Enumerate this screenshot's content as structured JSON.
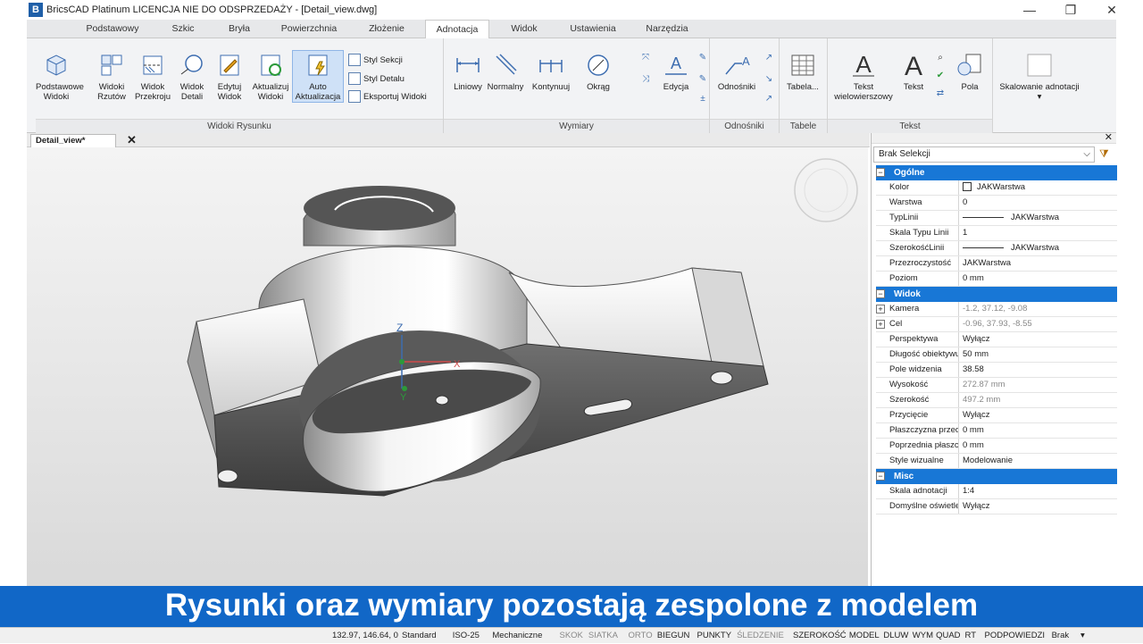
{
  "window": {
    "title": "BricsCAD Platinum LICENCJA NIE DO ODSPRZEDAŻY - [Detail_view.dwg]",
    "logo_letter": "B",
    "minimize": "—",
    "maximize": "❐",
    "close": "✕"
  },
  "ribbon_tabs": [
    "Podstawowy",
    "Szkic",
    "Bryła",
    "Powierzchnia",
    "Złożenie",
    "Adnotacja",
    "Widok",
    "Ustawienia",
    "Narzędzia"
  ],
  "active_tab": "Adnotacja",
  "panels": {
    "widoki": {
      "label": "Widoki Rysunku",
      "buttons": [
        {
          "line1": "Podstawowe",
          "line2": "Widoki"
        },
        {
          "line1": "Widoki",
          "line2": "Rzutów"
        },
        {
          "line1": "Widok",
          "line2": "Przekroju"
        },
        {
          "line1": "Widok",
          "line2": "Detali"
        },
        {
          "line1": "Edytuj",
          "line2": "Widok"
        },
        {
          "line1": "Aktualizuj",
          "line2": "Widoki"
        },
        {
          "line1": "Auto",
          "line2": "Aktualizacja"
        }
      ],
      "small": [
        "Styl Sekcji",
        "Styl Detalu",
        "Eksportuj Widoki"
      ]
    },
    "wymiary": {
      "label": "Wymiary",
      "buttons": [
        "Liniowy",
        "Normalny",
        "Kontynuuj",
        "Okrąg",
        "Edycja"
      ]
    },
    "odnosniki": {
      "label": "Odnośniki",
      "button": "Odnośniki"
    },
    "tabele": {
      "label": "Tabele",
      "button": "Tabela..."
    },
    "tekst": {
      "label": "Tekst",
      "buttons": [
        {
          "line1": "Tekst",
          "line2": "wielowierszowy"
        },
        {
          "line1": "Tekst",
          "line2": ""
        },
        {
          "line1": "Pola",
          "line2": ""
        }
      ]
    },
    "skalowanie": {
      "label": "Skalowanie adnotacji"
    }
  },
  "document_tab": {
    "label": "Detail_view*",
    "close": "✕"
  },
  "axes": {
    "z": "Z",
    "x": "X",
    "y": "Y"
  },
  "properties": {
    "selection": "Brak Selekcji",
    "sections": [
      {
        "title": "Ogólne",
        "rows": [
          {
            "key": "Kolor",
            "value": "JAKWarstwa"
          },
          {
            "key": "Warstwa",
            "value": "0"
          },
          {
            "key": "TypLinii",
            "value": "JAKWarstwa"
          },
          {
            "key": "Skala Typu Linii",
            "value": "1"
          },
          {
            "key": "SzerokośćLinii",
            "value": "JAKWarstwa"
          },
          {
            "key": "Przezroczystość",
            "value": "JAKWarstwa"
          },
          {
            "key": "Poziom",
            "value": "0 mm"
          }
        ]
      },
      {
        "title": "Widok",
        "rows": [
          {
            "key": "Kamera",
            "value": "-1.2, 37.12, -9.08"
          },
          {
            "key": "Cel",
            "value": "-0.96, 37.93, -8.55"
          },
          {
            "key": "Perspektywa",
            "value": "Wyłącz"
          },
          {
            "key": "Długość obiektywu",
            "value": "50 mm"
          },
          {
            "key": "Pole widzenia",
            "value": "38.58"
          },
          {
            "key": "Wysokość",
            "value": "272.87 mm"
          },
          {
            "key": "Szerokość",
            "value": "497.2 mm"
          },
          {
            "key": "Przycięcie",
            "value": "Wyłącz"
          },
          {
            "key": "Płaszczyzna przednia",
            "value": "0 mm"
          },
          {
            "key": "Poprzednia płaszczyzna",
            "value": "0 mm"
          },
          {
            "key": "Style wizualne",
            "value": "Modelowanie"
          }
        ]
      },
      {
        "title": "Misc",
        "rows": [
          {
            "key": "Skala adnotacji",
            "value": "1:4"
          },
          {
            "key": "Domyślne oświetlenie",
            "value": "Wyłącz"
          }
        ]
      }
    ]
  },
  "banner": "Rysunki oraz wymiary pozostają zespolone z modelem",
  "status": {
    "coords": "132.97, 146.64, 0",
    "items": [
      "Standard",
      "ISO-25",
      "Mechaniczne",
      "SKOK",
      "SIATKA",
      "ORTO",
      "BIEGUN",
      "PUNKTY",
      "ŚLEDZENIE",
      "SZEROKOŚĆ",
      "MODEL",
      "DLUW",
      "WYM",
      "QUAD",
      "RT",
      "PODPOWIEDZI",
      "Brak",
      "▾"
    ]
  }
}
